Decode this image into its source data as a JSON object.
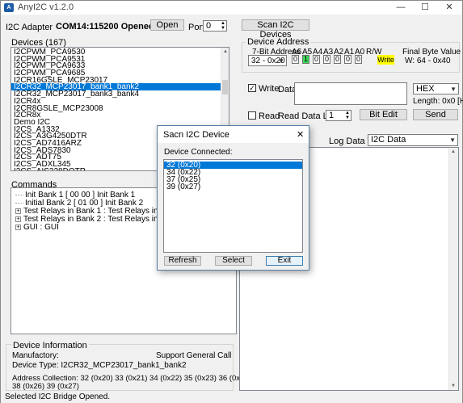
{
  "window": {
    "title": "AnyI2C v1.2.0",
    "minimize": "—",
    "maximize": "☐",
    "close": "✕"
  },
  "adapter": {
    "label": "I2C Adapter",
    "status": "COM14:115200 Opened",
    "open_button": "Open",
    "port_label": "Port",
    "port_value": "0"
  },
  "scan_button": "Scan I2C Devices",
  "devices": {
    "label": "Devices (167)",
    "items": [
      "I2CPWM_PCA9530",
      "I2CPWM_PCA9531",
      "I2CPWM_PCA9633",
      "I2CPWM_PCA9685",
      "I2CR16GSLE_MCP23017",
      "I2CR32_MCP23017_bank1_bank2",
      "I2CR32_MCP23017_bank3_bank4",
      "I2CR4x",
      "I2CR8GSLE_MCP23008",
      "I2CR8x",
      "Demo I2C",
      "I2CS_A1332",
      "I2CS_A3G4250DTR",
      "I2CS_AD7416ARZ",
      "I2CS_ADS7830",
      "I2CS_ADT75",
      "I2CS_ADXL345",
      "I2CS_AIS328DQTR",
      "I2CS_AMS5812_0050DB"
    ],
    "selected_index": 5
  },
  "commands": {
    "label": "Commands",
    "items": [
      {
        "text": "Init Bank 1 [ 00 00  ] Init Bank 1",
        "expandable": false
      },
      {
        "text": "Initial Bank 2 [ 01 00  ] Init Bank 2",
        "expandable": false
      },
      {
        "text": "Test Relays in Bank 1 : Test Relays in Bank 1",
        "expandable": true
      },
      {
        "text": "Test Relays in Bank 2 : Test Relays in Bank 2",
        "expandable": true
      },
      {
        "text": "GUI : GUI",
        "expandable": true
      }
    ]
  },
  "device_info": {
    "label": "Device Information",
    "manufactory": "Manufactory:",
    "support": "Support General Call",
    "device_type": "Device Type:  I2CR32_MCP23017_bank1_bank2",
    "address_line1": "Address Collection: 32 (0x20)  33 (0x21)  34 (0x22)  35 (0x23)  36 (0x24)  37 (0x25)",
    "address_line2": "38 (0x26)  39 (0x27)"
  },
  "device_address": {
    "label": "Device Address",
    "seven_bit_label": "7-Bit Address",
    "seven_bit_value": "32 - 0x20",
    "bit_headers": [
      "A6",
      "A5",
      "A4",
      "A3",
      "A2",
      "A1",
      "A0",
      "R/W"
    ],
    "bit_values": [
      "0",
      "1",
      "0",
      "0",
      "0",
      "0",
      "0"
    ],
    "bit_on_index": 1,
    "rw_value": "Write",
    "rw_color": "#ffff00",
    "bit_on_color": "#3ddc5b",
    "final_byte_label": "Final Byte Value",
    "final_byte_value": "W: 64 - 0x40"
  },
  "io": {
    "write_label": "Write",
    "write_checked": true,
    "data_label": "Data",
    "data_value": "",
    "format_value": "HEX",
    "length_text": "Length:  0x0 [Hex]",
    "read_label": "Read",
    "read_checked": false,
    "read_length_label": "Read Data Length",
    "read_length_value": "1",
    "bit_edit_button": "Bit Edit",
    "send_button": "Send",
    "log_type_label": "Log Data Type",
    "log_type_value": "I2C Data"
  },
  "scan_dialog": {
    "title": "Sacn I2C Device",
    "connected_label": "Device Connected:",
    "items": [
      "32  (0x20)",
      "34  (0x22)",
      "37  (0x25)",
      "39  (0x27)"
    ],
    "selected_index": 0,
    "refresh_button": "Refresh",
    "select_button": "Select",
    "exit_button": "Exit"
  },
  "status": {
    "text": "Selected I2C Bridge Opened."
  },
  "colors": {
    "selection": "#0078d7",
    "accent": "#1e5ca8"
  }
}
